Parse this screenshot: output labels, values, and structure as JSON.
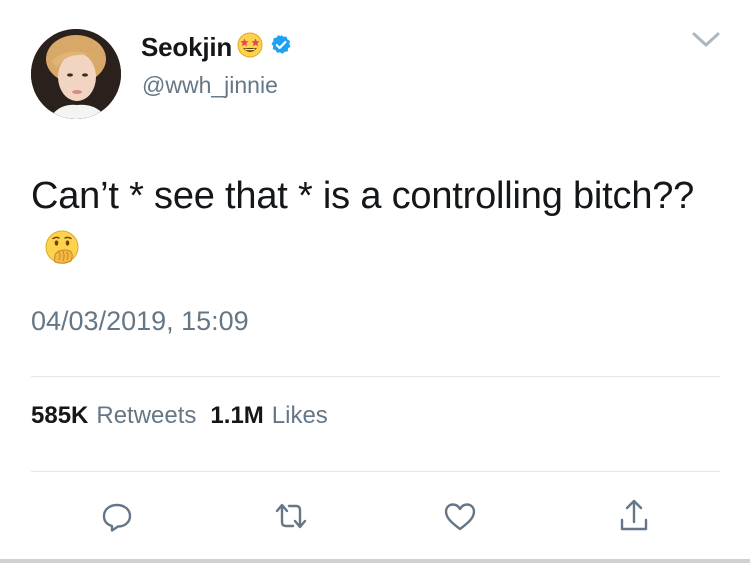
{
  "header": {
    "display_name": "Seokjin",
    "handle": "@wwh_jinnie",
    "icons": [
      "star-struck-emoji-icon",
      "verified-badge-icon",
      "chevron-down-icon"
    ]
  },
  "tweet": {
    "text": "Can’t * see that * is a controlling bitch??",
    "emoji_icon": "hand-over-mouth-emoji-icon",
    "timestamp": "04/03/2019, 15:09"
  },
  "stats": {
    "retweets_count": "585K",
    "retweets_label": "Retweets",
    "likes_count": "1.1M",
    "likes_label": "Likes"
  },
  "actions": [
    "reply-icon",
    "retweet-icon",
    "like-icon",
    "share-icon"
  ],
  "colors": {
    "text_primary": "#14171a",
    "text_secondary": "#657786",
    "divider": "#e1e8ed",
    "verified_blue": "#1da1f2",
    "emoji_yellow": "#fdd34e"
  }
}
